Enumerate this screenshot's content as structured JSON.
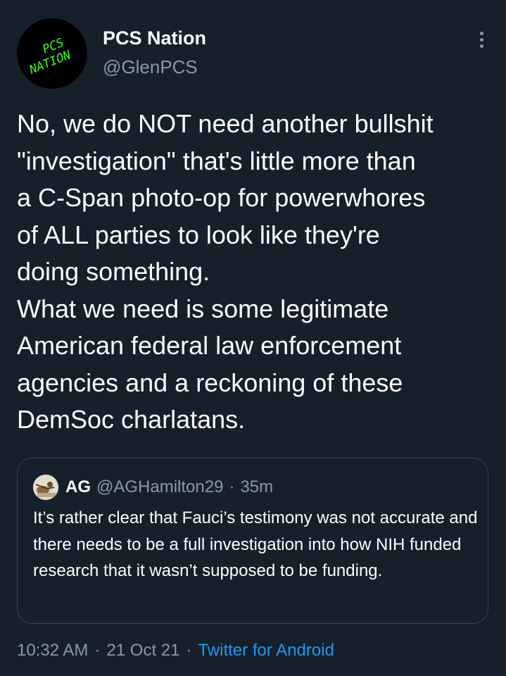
{
  "tweet": {
    "author": {
      "display_name": "PCS Nation",
      "handle": "@GlenPCS",
      "avatar_text_line1": "PCS",
      "avatar_text_line2": "NATION"
    },
    "more_icon": "more-vertical-icon",
    "text": "No, we do NOT need another bullshit\n\"investigation\" that's little more than\na C-Span photo-op for powerwhores\nof ALL parties to look like they're\ndoing something.\nWhat we need is some legitimate\nAmerican federal law enforcement\nagencies and a reckoning of these\nDemSoc charlatans.",
    "quoted": {
      "display_name": "AG",
      "handle": "@AGHamilton29",
      "separator": "·",
      "time_ago": "35m",
      "text": "It’s rather clear that Fauci’s testimony was not accurate and there needs to be a full investigation into how NIH funded research that it wasn’t supposed to be funding."
    },
    "meta": {
      "time": "10:32 AM",
      "separator1": "·",
      "date": "21 Oct 21",
      "separator2": "·",
      "source": "Twitter for Android"
    }
  },
  "colors": {
    "background": "#15202b",
    "primary_text": "#ffffff",
    "secondary_text": "#8b98a5",
    "link": "#1d9bf0",
    "border": "#38444d",
    "avatar_bg": "#000000",
    "avatar_logo": "#39ff14"
  }
}
